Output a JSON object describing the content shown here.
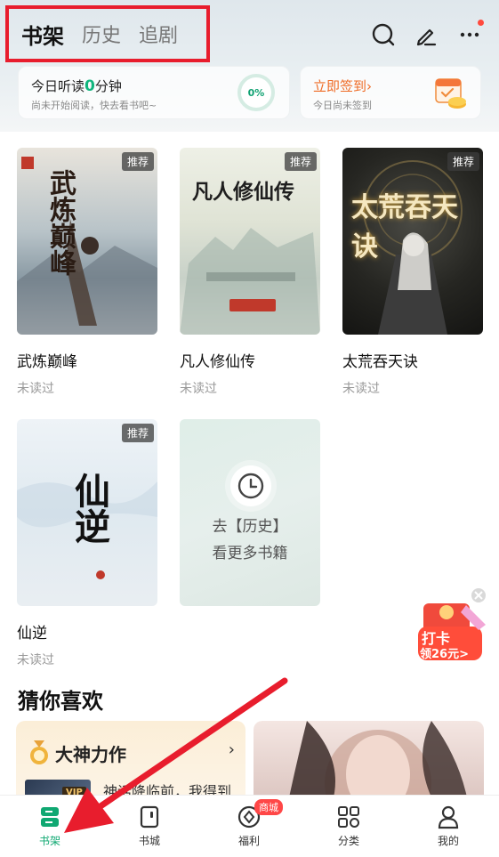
{
  "header": {
    "tabs": [
      {
        "label": "书架",
        "active": true
      },
      {
        "label": "历史",
        "active": false
      },
      {
        "label": "追剧",
        "active": false
      }
    ],
    "icons": [
      "search-icon",
      "edit-icon",
      "more-icon"
    ]
  },
  "listen_card": {
    "prefix": "今日听读",
    "minutes": "0",
    "suffix": "分钟",
    "subtitle": "尚未开始阅读，快去看书吧~",
    "progress": "0%"
  },
  "signin_card": {
    "title": "立即签到",
    "arrow": "›",
    "subtitle": "今日尚未签到"
  },
  "books": [
    {
      "title": "武炼巅峰",
      "status": "未读过",
      "badge": "推荐",
      "cover_text": "武炼巅峰"
    },
    {
      "title": "凡人修仙传",
      "status": "未读过",
      "badge": "推荐",
      "cover_text": "凡人修仙传"
    },
    {
      "title": "太荒吞天诀",
      "status": "未读过",
      "badge": "推荐",
      "cover_text": "太荒吞天诀"
    },
    {
      "title": "仙逆",
      "status": "未读过",
      "badge": "推荐",
      "cover_text": "仙逆"
    }
  ],
  "history_card": {
    "line1": "去【历史】",
    "line2": "看更多书籍"
  },
  "promo": {
    "line1": "打卡",
    "line2": "领26元>"
  },
  "recommend": {
    "title": "猜你喜欢",
    "master": {
      "title": "大神力作",
      "chevron": "›",
      "vip": "VIP",
      "desc": "神话降临前，我得到"
    }
  },
  "bottom_nav": [
    {
      "label": "书架",
      "active": true
    },
    {
      "label": "书城",
      "active": false
    },
    {
      "label": "福利",
      "active": false,
      "badge": "商城"
    },
    {
      "label": "分类",
      "active": false
    },
    {
      "label": "我的",
      "active": false
    }
  ],
  "colors": {
    "accent_green": "#10a872",
    "annotation_red": "#e81d2d",
    "signin_orange": "#ef6b25"
  }
}
